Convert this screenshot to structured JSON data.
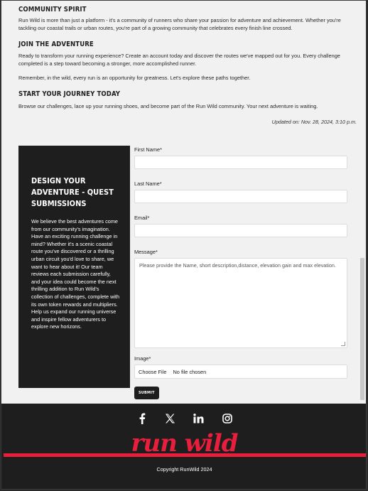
{
  "sections": [
    {
      "title": "COMMUNITY SPIRIT",
      "paragraphs": [
        "Run Wild is more than just a platform - it's a community of runners who share your passion for adventure and achievement. Whether you're tackling our coastal trails or urban routes, you're part of a growing community that celebrates every finish line crossed."
      ]
    },
    {
      "title": "JOIN THE ADVENTURE",
      "paragraphs": [
        "Ready to transform your running experience? Create an account today and discover the routes we've mapped out for you. Every challenge completed is a step toward becoming a stronger, more accomplished runner.",
        "Remember, in the wild, every run is an opportunity for greatness. Let's explore these paths together."
      ]
    },
    {
      "title": "START YOUR JOURNEY TODAY",
      "paragraphs": [
        "Browse our challenges, lace up your running shoes, and become part of the Run Wild community. Your next adventure is waiting."
      ]
    }
  ],
  "updated": "Updated on: Nov. 28, 2024, 3:10 p.m.",
  "quest": {
    "title": "DESIGN YOUR ADVENTURE - QUEST SUBMISSIONS",
    "body": "We believe the best adventures come from our community's imagination. Have an exciting running challenge in mind? Whether it's a scenic coastal route you've discovered or a thrilling urban circuit you'd love to share, we want to hear about it! Our team reviews each submission carefully, and your idea could become the next thrilling addition to Run Wild's collection of challenges, complete with its own token rewards and multipliers. Help us expand our running universe and inspire fellow adventurers to explore new horizons."
  },
  "form": {
    "first_name_label": "First Name*",
    "first_name_value": "",
    "last_name_label": "Last Name*",
    "last_name_value": "",
    "email_label": "Email*",
    "email_value": "",
    "message_label": "Message*",
    "message_placeholder": "Please provide the Name, short description,distance, elevation gain and max elevation.",
    "image_label": "Image*",
    "choose_file_label": "Choose File",
    "no_file_label": "No file chosen",
    "submit_label": "SUBMIT"
  },
  "footer": {
    "social_icons": [
      "facebook-icon",
      "x-icon",
      "linkedin-icon",
      "instagram-icon"
    ],
    "brand": "run wild",
    "copyright": "Copyright RunWild 2024"
  },
  "colors": {
    "accent": "#e91e3c",
    "dark": "#1e1e1e",
    "background": "#f1f1f1"
  }
}
